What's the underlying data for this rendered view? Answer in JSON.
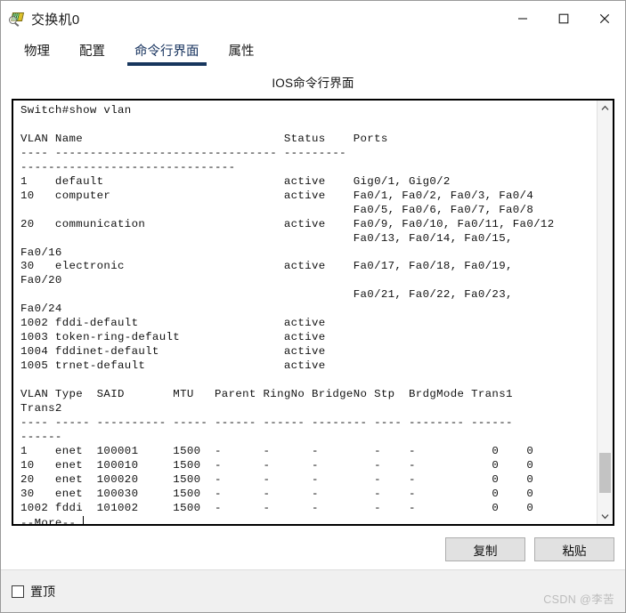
{
  "window": {
    "title": "交换机0",
    "icon": "switch-device-icon",
    "controls": {
      "minimize": "minimize-icon",
      "maximize": "maximize-icon",
      "close": "close-icon"
    }
  },
  "tabs": [
    {
      "label": "物理",
      "active": false
    },
    {
      "label": "配置",
      "active": false
    },
    {
      "label": "命令行界面",
      "active": true
    },
    {
      "label": "属性",
      "active": false
    }
  ],
  "panel": {
    "heading": "IOS命令行界面"
  },
  "terminal": {
    "prompt": "Switch#",
    "command": "show vlan",
    "more_prompt": "--More--",
    "text": "Switch#show vlan\n\nVLAN Name                             Status    Ports\n---- -------------------------------- --------- \n-------------------------------\n1    default                          active    Gig0/1, Gig0/2\n10   computer                         active    Fa0/1, Fa0/2, Fa0/3, Fa0/4\n                                                Fa0/5, Fa0/6, Fa0/7, Fa0/8\n20   communication                    active    Fa0/9, Fa0/10, Fa0/11, Fa0/12\n                                                Fa0/13, Fa0/14, Fa0/15, \nFa0/16\n30   electronic                       active    Fa0/17, Fa0/18, Fa0/19, \nFa0/20\n                                                Fa0/21, Fa0/22, Fa0/23, \nFa0/24\n1002 fddi-default                     active    \n1003 token-ring-default               active    \n1004 fddinet-default                  active    \n1005 trnet-default                    active    \n\nVLAN Type  SAID       MTU   Parent RingNo BridgeNo Stp  BrdgMode Trans1\nTrans2\n---- ----- ---------- ----- ------ ------ -------- ---- -------- ------\n------\n1    enet  100001     1500  -      -      -        -    -           0    0\n10   enet  100010     1500  -      -      -        -    -           0    0\n20   enet  100020     1500  -      -      -        -    -           0    0\n30   enet  100030     1500  -      -      -        -    -           0    0\n1002 fddi  101002     1500  -      -      -        -    -           0    0",
    "vlan_table": {
      "headers": [
        "VLAN",
        "Name",
        "Status",
        "Ports"
      ],
      "rows": [
        {
          "vlan": "1",
          "name": "default",
          "status": "active",
          "ports": [
            "Gig0/1, Gig0/2"
          ]
        },
        {
          "vlan": "10",
          "name": "computer",
          "status": "active",
          "ports": [
            "Fa0/1, Fa0/2, Fa0/3, Fa0/4",
            "Fa0/5, Fa0/6, Fa0/7, Fa0/8"
          ]
        },
        {
          "vlan": "20",
          "name": "communication",
          "status": "active",
          "ports": [
            "Fa0/9, Fa0/10, Fa0/11, Fa0/12",
            "Fa0/13, Fa0/14, Fa0/15, Fa0/16"
          ]
        },
        {
          "vlan": "30",
          "name": "electronic",
          "status": "active",
          "ports": [
            "Fa0/17, Fa0/18, Fa0/19, Fa0/20",
            "Fa0/21, Fa0/22, Fa0/23, Fa0/24"
          ]
        },
        {
          "vlan": "1002",
          "name": "fddi-default",
          "status": "active",
          "ports": []
        },
        {
          "vlan": "1003",
          "name": "token-ring-default",
          "status": "active",
          "ports": []
        },
        {
          "vlan": "1004",
          "name": "fddinet-default",
          "status": "active",
          "ports": []
        },
        {
          "vlan": "1005",
          "name": "trnet-default",
          "status": "active",
          "ports": []
        }
      ]
    },
    "detail_table": {
      "headers": [
        "VLAN",
        "Type",
        "SAID",
        "MTU",
        "Parent",
        "RingNo",
        "BridgeNo",
        "Stp",
        "BrdgMode",
        "Trans1",
        "Trans2"
      ],
      "rows": [
        [
          "1",
          "enet",
          "100001",
          "1500",
          "-",
          "-",
          "-",
          "-",
          "-",
          "0",
          "0"
        ],
        [
          "10",
          "enet",
          "100010",
          "1500",
          "-",
          "-",
          "-",
          "-",
          "-",
          "0",
          "0"
        ],
        [
          "20",
          "enet",
          "100020",
          "1500",
          "-",
          "-",
          "-",
          "-",
          "-",
          "0",
          "0"
        ],
        [
          "30",
          "enet",
          "100030",
          "1500",
          "-",
          "-",
          "-",
          "-",
          "-",
          "0",
          "0"
        ],
        [
          "1002",
          "fddi",
          "101002",
          "1500",
          "-",
          "-",
          "-",
          "-",
          "-",
          "0",
          "0"
        ]
      ]
    }
  },
  "actions": {
    "copy_label": "复制",
    "paste_label": "粘贴"
  },
  "footer": {
    "pin_label": "置顶",
    "pin_checked": false,
    "watermark": "CSDN @李苦"
  },
  "colors": {
    "accent": "#17365d",
    "tab_active_text": "#14305c",
    "terminal_text": "#121212",
    "button_face": "#e1e1e1",
    "footer_bg": "#f0f0f0",
    "watermark": "#bcbcbc"
  }
}
